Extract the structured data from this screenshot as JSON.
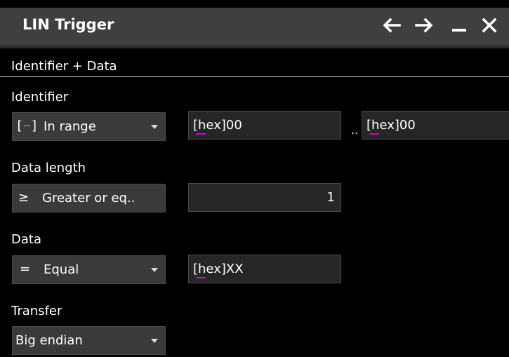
{
  "window": {
    "title": "LIN Trigger"
  },
  "section": {
    "title": "Identifier + Data"
  },
  "identifier": {
    "label": "Identifier",
    "condition": {
      "icon_left": "[",
      "icon_dash": "−",
      "icon_right": "]",
      "value": "In range"
    },
    "min": {
      "prefix": "[hex]",
      "value": "00"
    },
    "separator": "..",
    "max": {
      "prefix": "[hex]",
      "value": "00"
    }
  },
  "data_length": {
    "label": "Data length",
    "condition": {
      "icon": "≥",
      "value": "Greater or eq.."
    },
    "value": "1"
  },
  "data": {
    "label": "Data",
    "condition": {
      "icon": "=",
      "value": "Equal"
    },
    "pattern": {
      "prefix": "[hex]",
      "value": "XX"
    }
  },
  "transfer": {
    "label": "Transfer",
    "value": "Big endian"
  },
  "colors": {
    "titlebar": "#3f3f3f",
    "background": "#000000",
    "dropdown": "#3a3a3a",
    "field": "#262626",
    "hex_underline": "#d000d0",
    "range_icon_dash": "#e08000"
  },
  "icons": [
    "arrow-left-icon",
    "arrow-right-icon",
    "minimize-icon",
    "close-icon",
    "caret-down-icon",
    "in-range-icon"
  ]
}
